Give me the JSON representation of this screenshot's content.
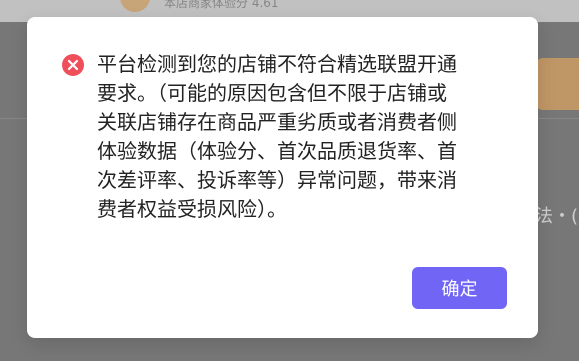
{
  "background": {
    "shop_score_text": "本店商家体验分 4.61",
    "right_snippet": "法・("
  },
  "dialog": {
    "icon": "error-circle-icon",
    "message_lines": [
      "平台检测到您的店铺不符合精选联盟开通",
      "要求。（可能的原因包含但不限于店铺或",
      "关联店铺存在商品严重劣质或者消费者侧",
      "体验数据（体验分、首次品质退货率、首",
      "次差评率、投诉率等）异常问题，带来消",
      "费者权益受损风险）。"
    ],
    "confirm_label": "确定"
  },
  "colors": {
    "overlay": "#777777",
    "dialog_background": "#ffffff",
    "error_icon": "#ef4f5b",
    "confirm_button": "#7165f6",
    "message_text": "#232323"
  }
}
